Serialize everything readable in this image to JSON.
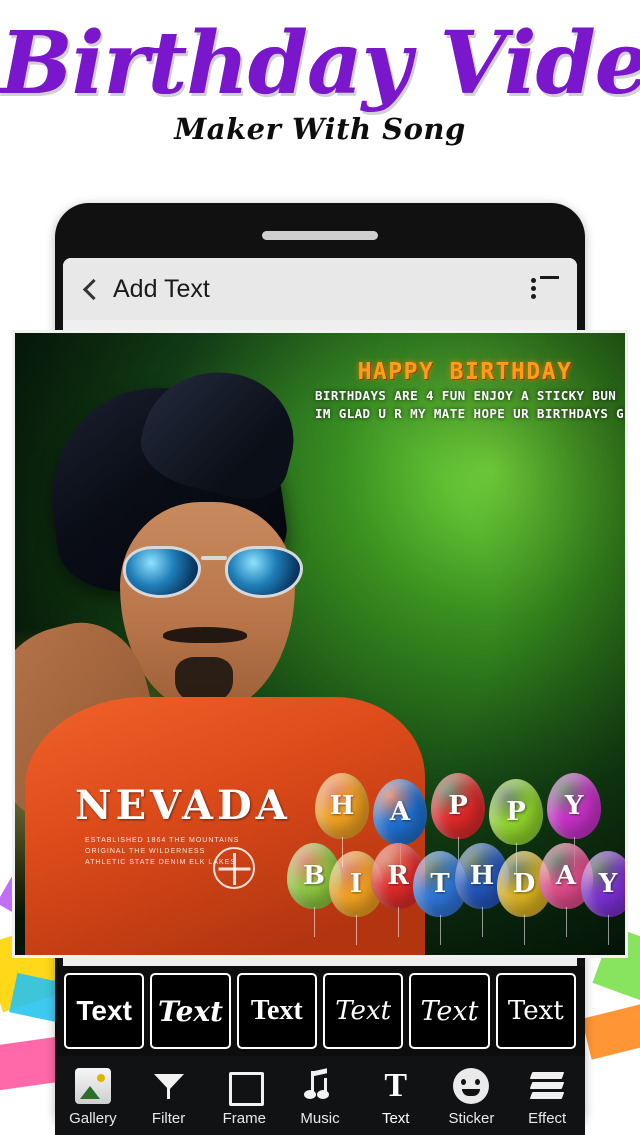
{
  "header": {
    "title_main": "Birthday Video",
    "title_sub": "Maker With Song"
  },
  "phone": {
    "appbar": {
      "back_icon": "chevron-left-icon",
      "title": "Add Text",
      "menu_icon": "list-menu-icon"
    }
  },
  "canvas": {
    "greeting": {
      "title": "HAPPY BIRTHDAY",
      "line1": "BIRTHDAYS ARE 4 FUN ENJOY A STICKY BUN",
      "line2": "IM GLAD U R MY MATE HOPE UR BIRTHDAYS GREAT."
    },
    "shirt": {
      "brand": "NEVADA",
      "sub_line1": "ESTABLISHED  1864  THE MOUNTAINS",
      "sub_line2": "ORIGINAL   THE WILDERNESS",
      "sub_line3": "ATHLETIC STATE DENIM        ELK LAKES"
    },
    "balloon_letters_row1": [
      "H",
      "A",
      "P",
      "P",
      "Y"
    ],
    "balloon_letters_row2": [
      "B",
      "I",
      "R",
      "T",
      "H",
      "D",
      "A",
      "Y"
    ],
    "balloon_colors_row1": [
      "#f0a020",
      "#1f6fd0",
      "#e02a2a",
      "#8fd22a",
      "#c830c8"
    ],
    "balloon_colors_row2": [
      "#8ec63f",
      "#f0a020",
      "#e02a2a",
      "#2e74d8",
      "#2255bb",
      "#d8b020",
      "#e04a8a",
      "#7a2fd0"
    ]
  },
  "font_strip": {
    "items": [
      {
        "label": "Text",
        "style": "sans-bold"
      },
      {
        "label": "Text",
        "style": "serif-italic-bold"
      },
      {
        "label": "Text",
        "style": "serif-bold"
      },
      {
        "label": "Text",
        "style": "script-light"
      },
      {
        "label": "Text",
        "style": "script-fancy"
      },
      {
        "label": "Text",
        "style": "blackletter"
      }
    ]
  },
  "toolbar": {
    "active": "Text",
    "items": [
      {
        "label": "Gallery",
        "icon": "gallery-icon"
      },
      {
        "label": "Filter",
        "icon": "filter-funnel-icon"
      },
      {
        "label": "Frame",
        "icon": "frame-icon"
      },
      {
        "label": "Music",
        "icon": "music-note-icon"
      },
      {
        "label": "Text",
        "icon": "text-t-icon"
      },
      {
        "label": "Sticker",
        "icon": "smiley-sticker-icon"
      },
      {
        "label": "Effect",
        "icon": "layers-effect-icon"
      }
    ]
  },
  "colors": {
    "brand_purple": "#7a17cc",
    "toolbar_bg": "#111214",
    "strip_bg": "#0d0d0d",
    "appbar_bg": "#e8e8e8"
  }
}
